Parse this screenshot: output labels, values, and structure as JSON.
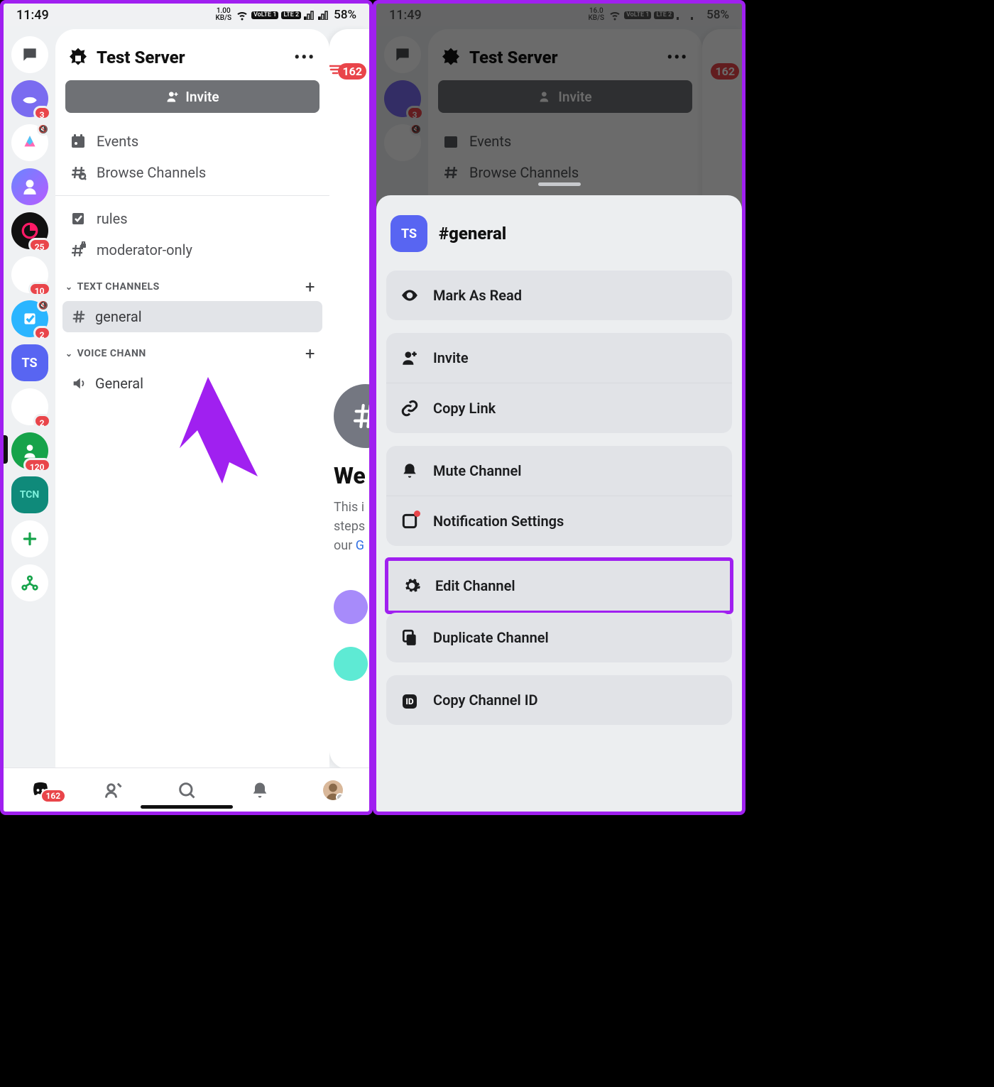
{
  "status": {
    "time": "11:49",
    "kbs_top": "1.00",
    "kbs2_top": "16.0",
    "kbs_unit": "KB/S",
    "lte1": "VoLTE 1",
    "lte2": "LTE 2",
    "battery": "58%"
  },
  "server": {
    "title": "Test Server",
    "invite_label": "Invite",
    "menu": {
      "events": "Events",
      "browse": "Browse Channels"
    },
    "pinned": [
      {
        "icon": "rules",
        "label": "rules"
      },
      {
        "icon": "lockhash",
        "label": "moderator-only"
      }
    ],
    "categories": [
      {
        "name": "TEXT CHANNELS",
        "channels": [
          {
            "icon": "hash",
            "label": "general",
            "active": true
          }
        ]
      },
      {
        "name": "VOICE CHANNELS",
        "channels": [
          {
            "icon": "speaker",
            "label": "General"
          }
        ],
        "truncated": "VOICE CHANN"
      }
    ]
  },
  "rail_badges": {
    "b1": "3",
    "b2": "25",
    "b3": "10",
    "b4": "2",
    "b5": "120",
    "b6": "2",
    "ts": "TS"
  },
  "peek": {
    "badge": "162",
    "welcome": "We",
    "p1": "This i",
    "p2": "steps",
    "p3": "our ",
    "link": "G"
  },
  "bnav": {
    "badge": "162"
  },
  "sheet": {
    "avatar": "TS",
    "title": "#general",
    "rows": {
      "mark_read": "Mark As Read",
      "invite": "Invite",
      "copy_link": "Copy Link",
      "mute": "Mute Channel",
      "notif": "Notification Settings",
      "edit": "Edit Channel",
      "dup": "Duplicate Channel",
      "copy_id": "Copy Channel ID"
    }
  }
}
